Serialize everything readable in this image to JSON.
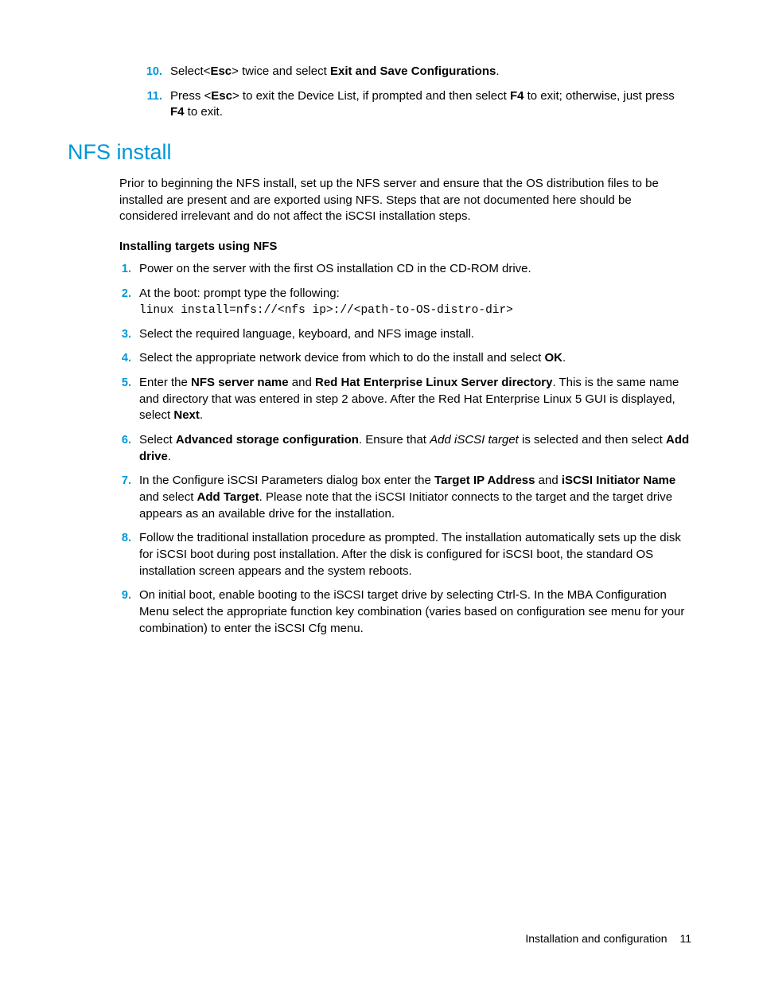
{
  "topList": {
    "item10": {
      "num": "10.",
      "t1": "Select<",
      "b1": "Esc",
      "t2": "> twice and select ",
      "b2": "Exit and Save Configurations",
      "t3": "."
    },
    "item11": {
      "num": "11.",
      "t1": "Press <",
      "b1": "Esc",
      "t2": "> to exit the Device List, if prompted and then select ",
      "b2": "F4",
      "t3": " to exit; otherwise, just press ",
      "b3": "F4",
      "t4": " to exit."
    }
  },
  "heading": "NFS install",
  "intro": "Prior to beginning the NFS install, set up the NFS server and ensure that the OS distribution files to be installed are present and are exported using NFS. Steps that are not documented here should be considered irrelevant and do not affect the iSCSI installation steps.",
  "subheading": "Installing targets using NFS",
  "mainList": {
    "s1": {
      "num": "1.",
      "text": "Power on the server with the first OS installation CD in the CD-ROM drive."
    },
    "s2": {
      "num": "2.",
      "line1": "At the boot: prompt type the following:",
      "code": "linux install=nfs://<nfs ip>://<path-to-OS-distro-dir>"
    },
    "s3": {
      "num": "3.",
      "text": "Select the required language, keyboard, and NFS image install."
    },
    "s4": {
      "num": "4.",
      "t1": "Select the appropriate network device from which to do the install and select ",
      "b1": "OK",
      "t2": "."
    },
    "s5": {
      "num": "5.",
      "t1": "Enter the ",
      "b1": "NFS server name",
      "t2": " and ",
      "b2": "Red Hat Enterprise Linux Server directory",
      "t3": ". This is the same name and directory that was entered in step 2 above. After the Red Hat Enterprise Linux 5 GUI is displayed, select ",
      "b3": "Next",
      "t4": "."
    },
    "s6": {
      "num": "6.",
      "t1": "Select ",
      "b1": "Advanced storage configuration",
      "t2": ". Ensure that ",
      "i1": "Add iSCSI target",
      "t3": " is selected and then select ",
      "b2": "Add drive",
      "t4": "."
    },
    "s7": {
      "num": "7.",
      "t1": "In the Configure iSCSI Parameters dialog box enter the ",
      "b1": "Target IP Address",
      "t2": " and ",
      "b2": "iSCSI Initiator Name",
      "t3": " and select ",
      "b3": "Add Target",
      "t4": ". Please note that the iSCSI Initiator connects to the target and the target drive appears as an available drive for the installation."
    },
    "s8": {
      "num": "8.",
      "text": "Follow the traditional installation procedure as prompted. The installation automatically sets up the disk for iSCSI boot during post installation. After the disk is configured for iSCSI boot, the standard OS installation screen appears and the system reboots."
    },
    "s9": {
      "num": "9.",
      "text": "On initial boot, enable booting to the iSCSI target drive by selecting Ctrl-S. In the MBA Configuration Menu select the appropriate function key combination (varies based on configuration see menu for your combination) to enter the iSCSI Cfg menu."
    }
  },
  "footer": {
    "section": "Installation and configuration",
    "page": "11"
  }
}
